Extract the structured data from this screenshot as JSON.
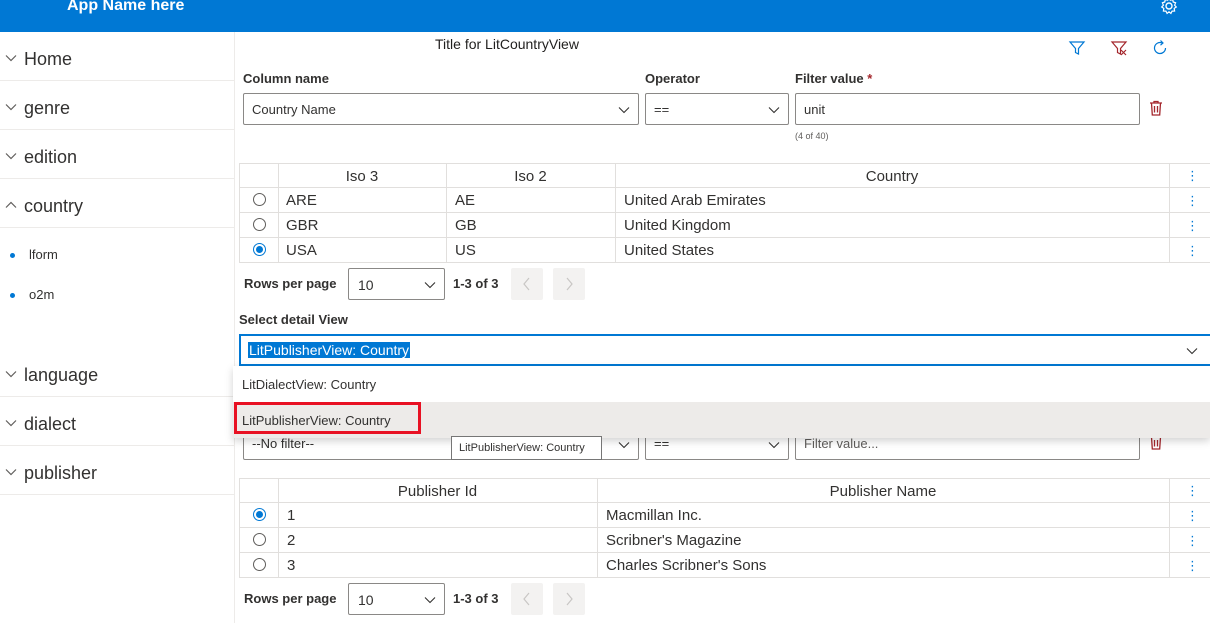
{
  "app": {
    "name": "App Name here"
  },
  "sidebar": {
    "items": [
      {
        "label": "Home"
      },
      {
        "label": "genre"
      },
      {
        "label": "edition"
      },
      {
        "label": "country"
      },
      {
        "label": "language"
      },
      {
        "label": "dialect"
      },
      {
        "label": "publisher"
      }
    ],
    "sub_items": [
      {
        "label": "lform"
      },
      {
        "label": "o2m"
      }
    ]
  },
  "view": {
    "title": "Title for LitCountryView"
  },
  "filter1": {
    "column_label": "Column name",
    "operator_label": "Operator",
    "value_label": "Filter value",
    "required_mark": "*",
    "column_value": "Country Name",
    "operator_value": "==",
    "filter_value": "unit",
    "count_hint": "(4 of 40)"
  },
  "country_table": {
    "headers": [
      "Iso 3",
      "Iso 2",
      "Country"
    ],
    "rows": [
      {
        "iso3": "ARE",
        "iso2": "AE",
        "country": "United Arab Emirates",
        "selected": false
      },
      {
        "iso3": "GBR",
        "iso2": "GB",
        "country": "United Kingdom",
        "selected": false
      },
      {
        "iso3": "USA",
        "iso2": "US",
        "country": "United States",
        "selected": true
      }
    ],
    "rows_per_page_label": "Rows per page",
    "rows_per_page": "10",
    "range": "1-3 of 3"
  },
  "detail": {
    "label": "Select detail View",
    "selected": "LitPublisherView: Country",
    "options": [
      "LitDialectView: Country",
      "LitPublisherView: Country"
    ],
    "tooltip": "LitPublisherView: Country"
  },
  "filter2": {
    "column_value": "--No filter--",
    "operator_value": "==",
    "placeholder": "Filter value..."
  },
  "publisher_table": {
    "headers": [
      "Publisher Id",
      "Publisher Name"
    ],
    "rows": [
      {
        "id": "1",
        "name": "Macmillan Inc.",
        "selected": true
      },
      {
        "id": "2",
        "name": "Scribner's Magazine",
        "selected": false
      },
      {
        "id": "3",
        "name": "Charles Scribner's Sons",
        "selected": false
      }
    ],
    "rows_per_page_label": "Rows per page",
    "rows_per_page": "10",
    "range": "1-3 of 3"
  },
  "colors": {
    "accent": "#0078d4",
    "danger": "#a4262c",
    "highlight": "#e81123"
  }
}
